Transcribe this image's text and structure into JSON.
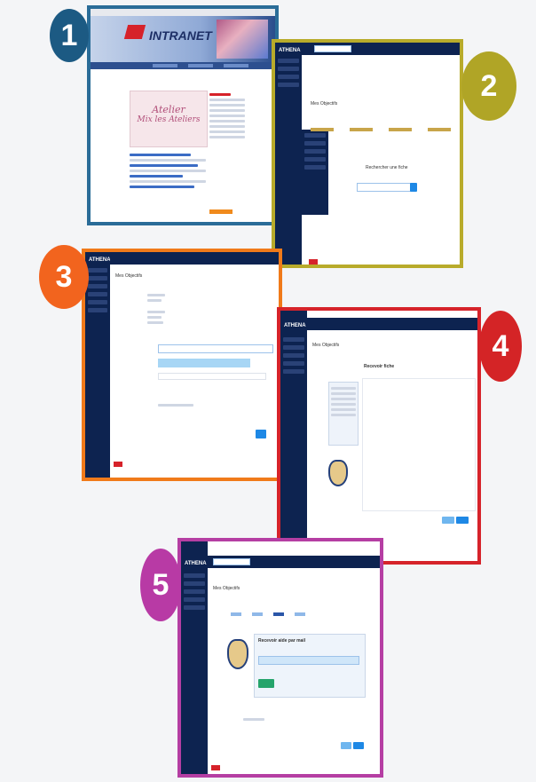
{
  "steps": [
    {
      "number": "1",
      "color": "#1c5a83"
    },
    {
      "number": "2",
      "color": "#b0a526"
    },
    {
      "number": "3",
      "color": "#f2641e"
    },
    {
      "number": "4",
      "color": "#d42426"
    },
    {
      "number": "5",
      "color": "#b83aa5"
    }
  ],
  "screen1": {
    "banner_title": "INTRANET",
    "card_script_line1": "Atelier",
    "card_script_line2": "Mix les Ateliers"
  },
  "screen2": {
    "app_name": "ATHENA",
    "page_title": "Mes Objectifs",
    "search_heading": "Rechercher une fiche"
  },
  "screen3": {
    "app_name": "ATHENA",
    "page_title": "Mes Objectifs"
  },
  "screen4": {
    "app_name": "ATHENA",
    "page_title": "Mes Objectifs",
    "panel_heading": "Recevoir fiche"
  },
  "screen5": {
    "app_name": "ATHENA",
    "page_title": "Mes Objectifs",
    "panel_heading": "Recevoir aide par mail"
  }
}
